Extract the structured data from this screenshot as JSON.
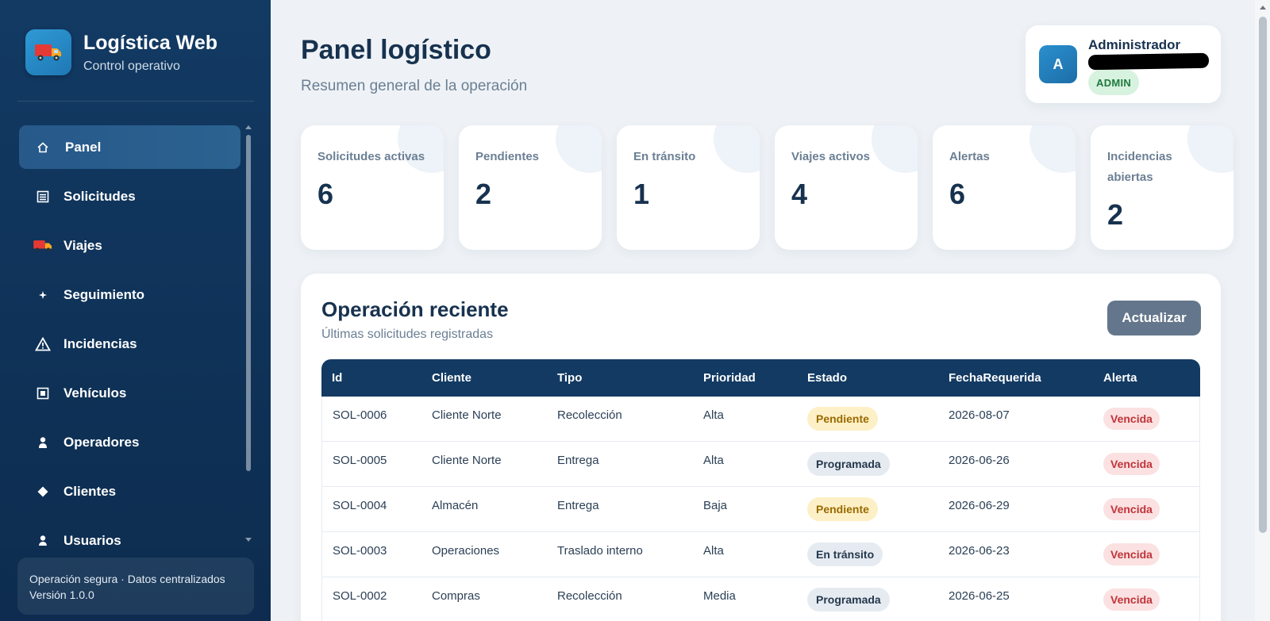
{
  "brand": {
    "title": "Logística Web",
    "subtitle": "Control operativo",
    "logo_icon": "truck-icon"
  },
  "sidebar": {
    "items": [
      {
        "label": "Panel",
        "icon": "home-icon",
        "active": true
      },
      {
        "label": "Solicitudes",
        "icon": "list-icon"
      },
      {
        "label": "Viajes",
        "icon": "truck-icon"
      },
      {
        "label": "Seguimiento",
        "icon": "sparkle-icon"
      },
      {
        "label": "Incidencias",
        "icon": "warning-icon"
      },
      {
        "label": "Vehículos",
        "icon": "square-icon"
      },
      {
        "label": "Operadores",
        "icon": "person-icon"
      },
      {
        "label": "Clientes",
        "icon": "diamond-icon"
      },
      {
        "label": "Usuarios",
        "icon": "person-icon"
      }
    ],
    "footer_line1": "Operación segura · Datos centralizados",
    "footer_line2": "Versión 1.0.0"
  },
  "header": {
    "title": "Panel logístico",
    "subtitle": "Resumen general de la operación"
  },
  "user": {
    "avatar_letter": "A",
    "name": "Administrador",
    "role": "ADMIN"
  },
  "stats": [
    {
      "label": "Solicitudes activas",
      "value": "6"
    },
    {
      "label": "Pendientes",
      "value": "2"
    },
    {
      "label": "En tránsito",
      "value": "1"
    },
    {
      "label": "Viajes activos",
      "value": "4"
    },
    {
      "label": "Alertas",
      "value": "6"
    },
    {
      "label": "Incidencias abiertas",
      "value": "2"
    }
  ],
  "recent": {
    "title": "Operación reciente",
    "subtitle": "Últimas solicitudes registradas",
    "refresh_label": "Actualizar",
    "columns": [
      "Id",
      "Cliente",
      "Tipo",
      "Prioridad",
      "Estado",
      "FechaRequerida",
      "Alerta"
    ],
    "rows": [
      {
        "id": "SOL-0006",
        "cliente": "Cliente Norte",
        "tipo": "Recolección",
        "prioridad": "Alta",
        "estado": "Pendiente",
        "fecha": "2026-08-07",
        "alerta": "Vencida"
      },
      {
        "id": "SOL-0005",
        "cliente": "Cliente Norte",
        "tipo": "Entrega",
        "prioridad": "Alta",
        "estado": "Programada",
        "fecha": "2026-06-26",
        "alerta": "Vencida"
      },
      {
        "id": "SOL-0004",
        "cliente": "Almacén",
        "tipo": "Entrega",
        "prioridad": "Baja",
        "estado": "Pendiente",
        "fecha": "2026-06-29",
        "alerta": "Vencida"
      },
      {
        "id": "SOL-0003",
        "cliente": "Operaciones",
        "tipo": "Traslado interno",
        "prioridad": "Alta",
        "estado": "En tránsito",
        "fecha": "2026-06-23",
        "alerta": "Vencida"
      },
      {
        "id": "SOL-0002",
        "cliente": "Compras",
        "tipo": "Recolección",
        "prioridad": "Media",
        "estado": "Programada",
        "fecha": "2026-06-25",
        "alerta": "Vencida"
      }
    ]
  }
}
